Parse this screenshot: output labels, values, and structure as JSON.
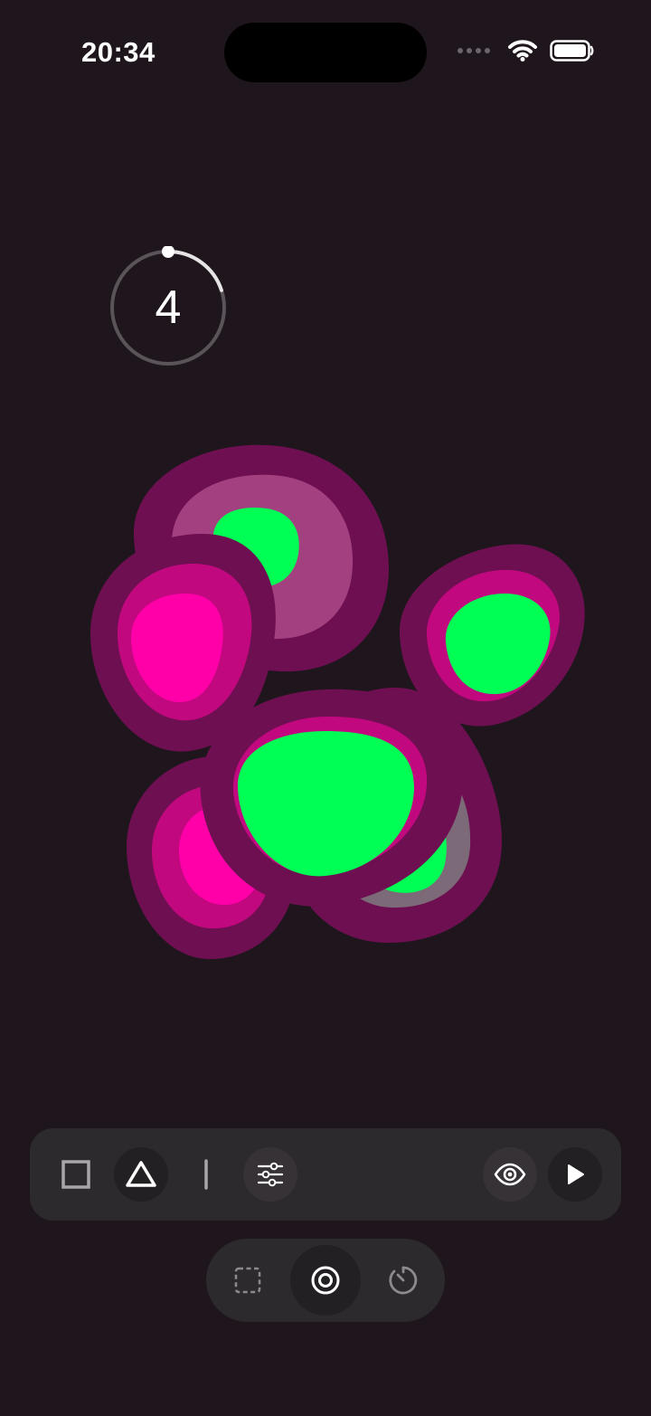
{
  "status_bar": {
    "time": "20:34",
    "icons": [
      "cellular-signal-icon",
      "wifi-icon",
      "battery-icon"
    ]
  },
  "counter": {
    "value": "4",
    "progress_fraction": 0.2
  },
  "colors": {
    "background": "#1f161d",
    "blob_outer": "#6d0f50",
    "blob_mid": "#c1087f",
    "blob_pale": "#a3407f",
    "accent_green": "#00ff55",
    "accent_pink": "#ff00a8",
    "toolbar_bg": "#2d2a2d"
  },
  "toolbar": {
    "items": [
      {
        "name": "square-icon",
        "active": false
      },
      {
        "name": "triangle-icon",
        "active": true
      },
      {
        "name": "line-icon",
        "active": false
      },
      {
        "name": "sliders-icon",
        "active": false
      },
      {
        "name": "eye-icon",
        "active": false
      },
      {
        "name": "play-icon",
        "active": false
      }
    ]
  },
  "mode_bar": {
    "items": [
      {
        "name": "dashed-square-icon",
        "active": false
      },
      {
        "name": "target-icon",
        "active": true
      },
      {
        "name": "timer-icon",
        "active": false
      }
    ]
  }
}
